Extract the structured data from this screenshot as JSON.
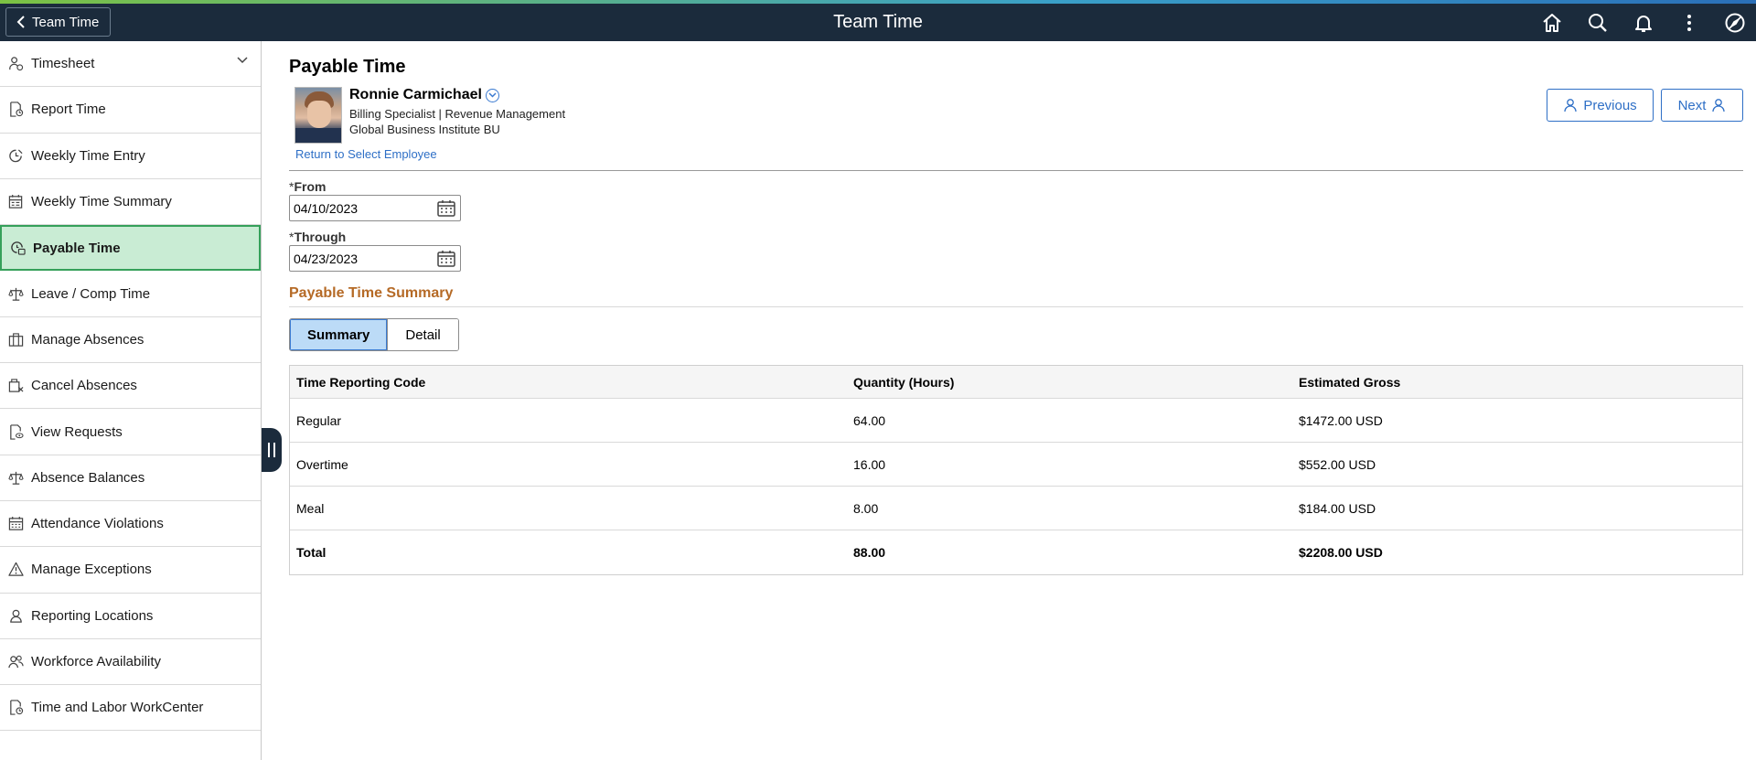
{
  "topbar": {
    "back_label": "Team Time",
    "title": "Team Time",
    "icons": [
      "home-icon",
      "search-icon",
      "bell-icon",
      "more-icon",
      "navbar-icon"
    ]
  },
  "sidebar": {
    "items": [
      {
        "label": "Timesheet",
        "icon": "timesheet-icon",
        "expandable": true
      },
      {
        "label": "Report Time",
        "icon": "report-time-icon"
      },
      {
        "label": "Weekly Time Entry",
        "icon": "weekly-entry-icon"
      },
      {
        "label": "Weekly Time Summary",
        "icon": "weekly-summary-icon"
      },
      {
        "label": "Payable Time",
        "icon": "payable-time-icon",
        "active": true
      },
      {
        "label": "Leave / Comp Time",
        "icon": "scale-icon"
      },
      {
        "label": "Manage Absences",
        "icon": "briefcase-icon"
      },
      {
        "label": "Cancel Absences",
        "icon": "cancel-absence-icon"
      },
      {
        "label": "View Requests",
        "icon": "view-requests-icon"
      },
      {
        "label": "Absence Balances",
        "icon": "balance-icon"
      },
      {
        "label": "Attendance Violations",
        "icon": "calendar-icon"
      },
      {
        "label": "Manage Exceptions",
        "icon": "warning-icon"
      },
      {
        "label": "Reporting Locations",
        "icon": "location-icon"
      },
      {
        "label": "Workforce Availability",
        "icon": "people-icon"
      },
      {
        "label": "Time and Labor WorkCenter",
        "icon": "workcenter-icon"
      }
    ]
  },
  "page": {
    "title": "Payable Time"
  },
  "employee": {
    "name": "Ronnie Carmichael",
    "job": "Billing Specialist | Revenue Management",
    "bu": "Global Business Institute BU",
    "return_link": "Return to Select Employee"
  },
  "nav": {
    "previous_label": "Previous",
    "next_label": "Next"
  },
  "filters": {
    "required_mark": "*",
    "from_label": "From",
    "from_value": "04/10/2023",
    "through_label": "Through",
    "through_value": "04/23/2023"
  },
  "summary": {
    "section_title": "Payable Time Summary",
    "tabs": [
      "Summary",
      "Detail"
    ],
    "active_tab": "Summary",
    "columns": [
      "Time Reporting Code",
      "Quantity (Hours)",
      "Estimated Gross"
    ],
    "rows": [
      [
        "Regular",
        "64.00",
        "$1472.00 USD"
      ],
      [
        "Overtime",
        "16.00",
        "$552.00 USD"
      ],
      [
        "Meal",
        "8.00",
        "$184.00 USD"
      ]
    ],
    "total": [
      "Total",
      "88.00",
      "$2208.00 USD"
    ]
  },
  "colors": {
    "topbar_bg": "#1b2b3c",
    "active_item_bg": "#c9ecd4",
    "active_item_border": "#35a05a",
    "section_title": "#b56a26",
    "link": "#2e6fc6",
    "selected_tab_bg": "#bcdbf7"
  }
}
